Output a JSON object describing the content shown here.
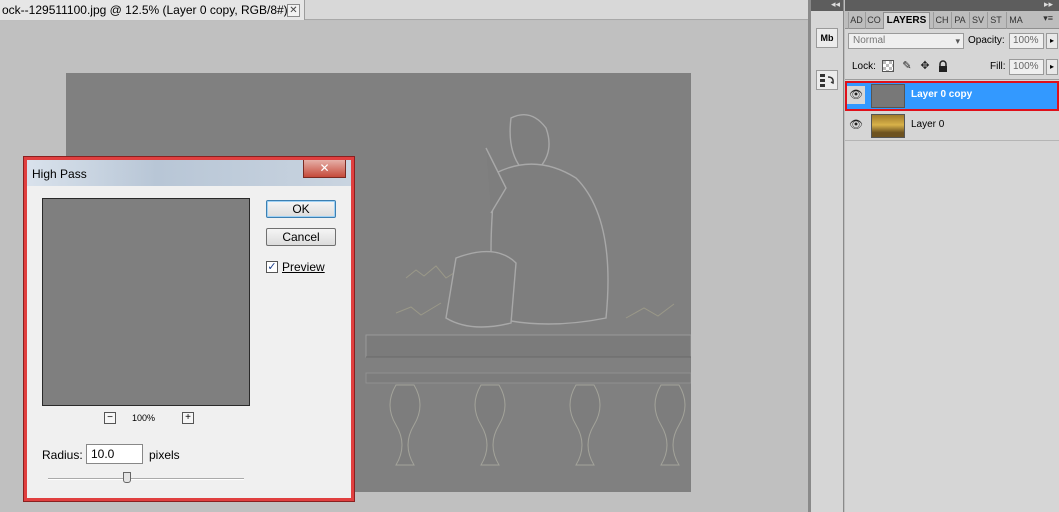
{
  "document": {
    "tab_title": "ock--129511100.jpg @ 12.5% (Layer 0 copy, RGB/8#) *",
    "close_glyph": "✕"
  },
  "dock": {
    "collapse_glyph": "◂◂",
    "mini_bridge_label": "Mb",
    "history_icon": "history-icon"
  },
  "layers_panel": {
    "top_glyph": "▸▸",
    "tabs": [
      {
        "label": "AD"
      },
      {
        "label": "CO"
      },
      {
        "label": "LAYERS"
      },
      {
        "label": "CH"
      },
      {
        "label": "PA"
      },
      {
        "label": "SV"
      },
      {
        "label": "ST"
      },
      {
        "label": "MA"
      }
    ],
    "active_tab": "LAYERS",
    "menu_glyph": "▾≡",
    "blend_mode": "Normal",
    "opacity_label": "Opacity:",
    "opacity_value": "100%",
    "lock_label": "Lock:",
    "lock_icons": [
      "lock-transparency-icon",
      "lock-paint-icon",
      "lock-position-icon",
      "lock-all-icon"
    ],
    "fill_label": "Fill:",
    "fill_value": "100%",
    "layers": [
      {
        "name": "Layer 0 copy",
        "visible": true,
        "selected": true
      },
      {
        "name": "Layer 0",
        "visible": true,
        "selected": false
      }
    ]
  },
  "high_pass_dialog": {
    "title": "High Pass",
    "close_glyph": "✕",
    "ok_label": "OK",
    "cancel_label": "Cancel",
    "preview_label": "Preview",
    "preview_checked": true,
    "zoom_out_label": "−",
    "zoom_in_label": "+",
    "zoom_level": "100%",
    "radius_label": "Radius:",
    "radius_value": "10.0",
    "radius_unit": "pixels"
  },
  "colors": {
    "selection_blue": "#3399ff",
    "highlight_red": "#e0101a",
    "canvas_gray": "#7f7f7f"
  }
}
